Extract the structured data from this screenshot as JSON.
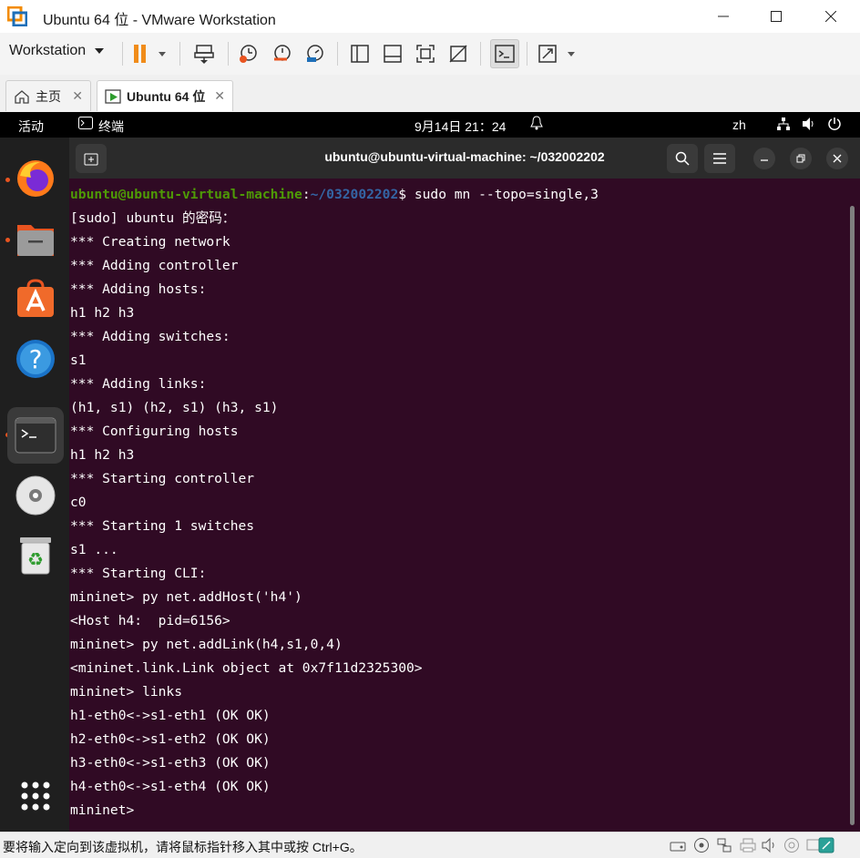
{
  "window": {
    "title": "Ubuntu 64 位 - VMware Workstation",
    "controls": [
      "minimize",
      "maximize",
      "close"
    ]
  },
  "toolbar": {
    "menu_label": "Workstation"
  },
  "tabs": [
    {
      "label": "主页",
      "active": false
    },
    {
      "label": "Ubuntu 64 位",
      "active": true
    }
  ],
  "ubuntu_topbar": {
    "activities": "活动",
    "app": "终端",
    "datetime": "9月14日  21：24",
    "input_method": "zh"
  },
  "dock": [
    "firefox-icon",
    "files-icon",
    "software-icon",
    "help-icon",
    "terminal-icon",
    "dvd-icon",
    "trash-icon",
    "app-grid-icon"
  ],
  "terminal": {
    "title": "ubuntu@ubuntu-virtual-machine: ~/032002202",
    "prompt_user": "ubuntu@ubuntu-virtual-machine",
    "prompt_path": "~/032002202",
    "prompt_command": "$ sudo mn --topo=single,3",
    "lines": [
      "[sudo] ubuntu 的密码：",
      "*** Creating network",
      "*** Adding controller",
      "*** Adding hosts:",
      "h1 h2 h3",
      "*** Adding switches:",
      "s1",
      "*** Adding links:",
      "(h1, s1) (h2, s1) (h3, s1)",
      "*** Configuring hosts",
      "h1 h2 h3",
      "*** Starting controller",
      "c0",
      "*** Starting 1 switches",
      "s1 ...",
      "*** Starting CLI:",
      "mininet> py net.addHost('h4')",
      "<Host h4:  pid=6156>",
      "mininet> py net.addLink(h4,s1,0,4)",
      "<mininet.link.Link object at 0x7f11d2325300>",
      "mininet> links",
      "h1-eth0<->s1-eth1 (OK OK)",
      "h2-eth0<->s1-eth2 (OK OK)",
      "h3-eth0<->s1-eth3 (OK OK)",
      "h4-eth0<->s1-eth4 (OK OK)",
      "mininet>"
    ]
  },
  "statusbar": {
    "message": "要将输入定向到该虚拟机，请将鼠标指针移入其中或按 Ctrl+G。"
  }
}
